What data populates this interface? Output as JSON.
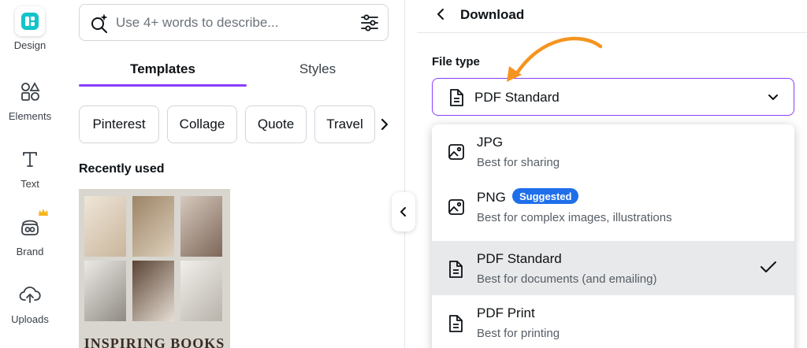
{
  "sidebar": {
    "items": [
      {
        "label": "Design",
        "icon": "design-logo-icon"
      },
      {
        "label": "Elements",
        "icon": "shapes-icon"
      },
      {
        "label": "Text",
        "icon": "text-T-icon"
      },
      {
        "label": "Brand",
        "icon": "brand-icon"
      },
      {
        "label": "Uploads",
        "icon": "cloud-upload-icon"
      }
    ]
  },
  "search": {
    "placeholder": "Use 4+ words to describe..."
  },
  "tabs": {
    "templates": "Templates",
    "styles": "Styles"
  },
  "chips": [
    "Pinterest",
    "Collage",
    "Quote",
    "Travel"
  ],
  "recent": {
    "title": "Recently used",
    "thumbnail_title": "INSPIRING BOOKS"
  },
  "download": {
    "title": "Download",
    "file_type_label": "File type",
    "selected": "PDF Standard",
    "options": [
      {
        "title": "JPG",
        "desc": "Best for sharing",
        "icon": "image-icon"
      },
      {
        "title": "PNG",
        "desc": "Best for complex images, illustrations",
        "badge": "Suggested",
        "icon": "image-icon"
      },
      {
        "title": "PDF Standard",
        "desc": "Best for documents (and emailing)",
        "icon": "document-icon",
        "selected": true
      },
      {
        "title": "PDF Print",
        "desc": "Best for printing",
        "icon": "document-icon"
      }
    ]
  },
  "colors": {
    "accent": "#8b3dff",
    "badge": "#1f6feb",
    "arrow": "#f5941f",
    "brand_teal": "#13c4c9"
  }
}
